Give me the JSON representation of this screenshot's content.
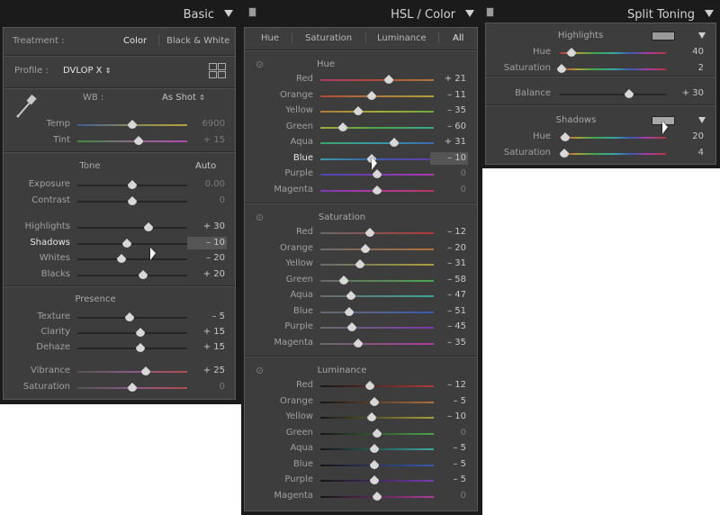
{
  "basic": {
    "title": "Basic",
    "treatment_label": "Treatment :",
    "treatment_options": [
      "Color",
      "Black & White"
    ],
    "profile_label": "Profile :",
    "profile_value": "DVLOP X",
    "wb_label": "WB :",
    "wb_value": "As Shot",
    "sliders_wb": [
      {
        "label": "Temp",
        "value": "6900",
        "pos": 0.5,
        "dim": true
      },
      {
        "label": "Tint",
        "value": "+ 15",
        "pos": 0.56,
        "dim": true
      }
    ],
    "tone_title": "Tone",
    "auto_label": "Auto",
    "sliders_tone1": [
      {
        "label": "Exposure",
        "value": "0.00",
        "pos": 0.5,
        "dim": true
      },
      {
        "label": "Contrast",
        "value": "0",
        "pos": 0.5,
        "dim": true
      }
    ],
    "sliders_tone2": [
      {
        "label": "Highlights",
        "value": "+ 30",
        "pos": 0.65
      },
      {
        "label": "Shadows",
        "value": "– 10",
        "pos": 0.45,
        "active": true
      },
      {
        "label": "Whites",
        "value": "– 20",
        "pos": 0.4
      },
      {
        "label": "Blacks",
        "value": "+ 20",
        "pos": 0.6
      }
    ],
    "presence_title": "Presence",
    "sliders_presence1": [
      {
        "label": "Texture",
        "value": "– 5",
        "pos": 0.475
      },
      {
        "label": "Clarity",
        "value": "+ 15",
        "pos": 0.575
      },
      {
        "label": "Dehaze",
        "value": "+ 15",
        "pos": 0.575
      }
    ],
    "sliders_presence2": [
      {
        "label": "Vibrance",
        "value": "+ 25",
        "pos": 0.625
      },
      {
        "label": "Saturation",
        "value": "0",
        "pos": 0.5,
        "dim": true
      }
    ]
  },
  "hsl": {
    "title": "HSL / Color",
    "tabs": [
      "Hue",
      "Saturation",
      "Luminance",
      "All"
    ],
    "hue_title": "Hue",
    "hue": [
      {
        "label": "Red",
        "value": "+ 21",
        "pos": 0.6
      },
      {
        "label": "Orange",
        "value": "– 11",
        "pos": 0.45
      },
      {
        "label": "Yellow",
        "value": "– 35",
        "pos": 0.33
      },
      {
        "label": "Green",
        "value": "– 60",
        "pos": 0.2
      },
      {
        "label": "Aqua",
        "value": "+ 31",
        "pos": 0.65
      },
      {
        "label": "Blue",
        "value": "– 10",
        "pos": 0.45,
        "active": true
      },
      {
        "label": "Purple",
        "value": "0",
        "pos": 0.5,
        "dim": true
      },
      {
        "label": "Magenta",
        "value": "0",
        "pos": 0.5,
        "dim": true
      }
    ],
    "sat_title": "Saturation",
    "saturation": [
      {
        "label": "Red",
        "value": "– 12",
        "pos": 0.44
      },
      {
        "label": "Orange",
        "value": "– 20",
        "pos": 0.4
      },
      {
        "label": "Yellow",
        "value": "– 31",
        "pos": 0.35
      },
      {
        "label": "Green",
        "value": "– 58",
        "pos": 0.21
      },
      {
        "label": "Aqua",
        "value": "– 47",
        "pos": 0.27
      },
      {
        "label": "Blue",
        "value": "– 51",
        "pos": 0.25
      },
      {
        "label": "Purple",
        "value": "– 45",
        "pos": 0.28
      },
      {
        "label": "Magenta",
        "value": "– 35",
        "pos": 0.33
      }
    ],
    "lum_title": "Luminance",
    "luminance": [
      {
        "label": "Red",
        "value": "– 12",
        "pos": 0.44
      },
      {
        "label": "Orange",
        "value": "– 5",
        "pos": 0.475
      },
      {
        "label": "Yellow",
        "value": "– 10",
        "pos": 0.45
      },
      {
        "label": "Green",
        "value": "0",
        "pos": 0.5,
        "dim": true
      },
      {
        "label": "Aqua",
        "value": "– 5",
        "pos": 0.475
      },
      {
        "label": "Blue",
        "value": "– 5",
        "pos": 0.475
      },
      {
        "label": "Purple",
        "value": "– 5",
        "pos": 0.475
      },
      {
        "label": "Magenta",
        "value": "0",
        "pos": 0.5,
        "dim": true
      }
    ]
  },
  "split": {
    "title": "Split Toning",
    "highlights_title": "Highlights",
    "highlights": [
      {
        "label": "Hue",
        "value": "40",
        "pos": 0.11
      },
      {
        "label": "Saturation",
        "value": "2",
        "pos": 0.02
      }
    ],
    "balance": {
      "label": "Balance",
      "value": "+ 30",
      "pos": 0.65
    },
    "shadows_title": "Shadows",
    "shadows": [
      {
        "label": "Hue",
        "value": "20",
        "pos": 0.055
      },
      {
        "label": "Saturation",
        "value": "4",
        "pos": 0.04
      }
    ]
  },
  "colors": {
    "panel_bg": "#3d3d3d",
    "frame": "#1b1b1b",
    "text": "#b4b4b4"
  }
}
